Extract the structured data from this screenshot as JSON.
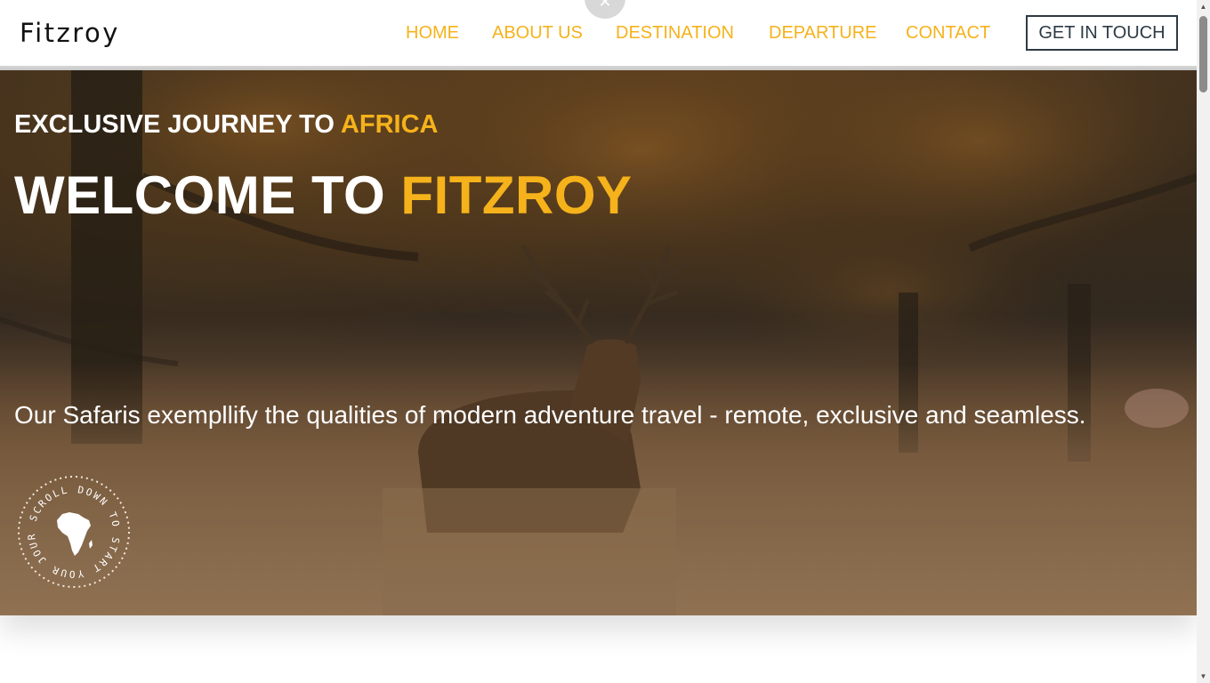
{
  "brand": {
    "logo_text": "Fitzroy"
  },
  "nav": {
    "links": [
      "HOME",
      "ABOUT US",
      "DESTINATION",
      "DEPARTURE",
      "CONTACT"
    ],
    "cta_label": "GET IN TOUCH",
    "close_glyph": "✕"
  },
  "hero": {
    "subtitle_prefix": "EXCLUSIVE JOURNEY TO",
    "subtitle_accent": "AFRICA",
    "title_prefix": "WELCOME TO",
    "title_accent": "FITZROY",
    "description": "Our Safaris exempllify the qualities of modern adventure travel - remote, exclusive and seamless.",
    "scroll_badge_text": "SCROLL DOWN TO START YOUR JOURNEY",
    "background_icon": "deer-in-forest-photo"
  },
  "colors": {
    "accent": "#f5b21b",
    "cta_border": "#2d3a44",
    "text_dark": "#111111",
    "hero_text": "#ffffff"
  },
  "scrollbar": {
    "up_icon": "▲",
    "down_icon": "▼"
  }
}
